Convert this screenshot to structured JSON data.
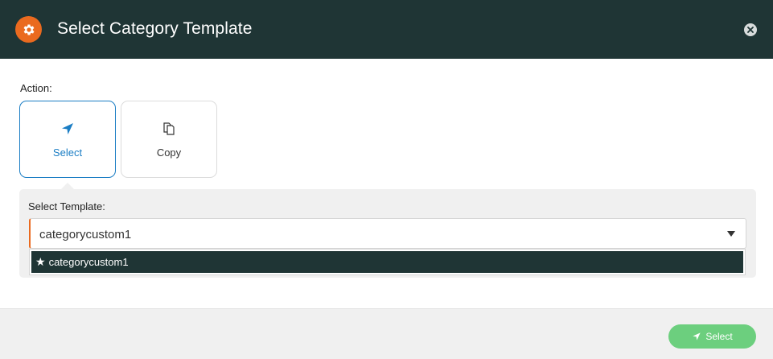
{
  "dialog": {
    "title": "Select Category Template",
    "header_icon": "gear-icon",
    "close_icon": "close-icon"
  },
  "action": {
    "label": "Action:",
    "options": [
      {
        "label": "Select",
        "icon": "send-icon",
        "selected": true
      },
      {
        "label": "Copy",
        "icon": "copy-icon",
        "selected": false
      }
    ]
  },
  "template": {
    "label": "Select Template:",
    "value": "categorycustom1",
    "options": [
      {
        "label": "categorycustom1",
        "icon": "star-icon",
        "highlighted": true
      }
    ]
  },
  "footer": {
    "select_button_label": "Select",
    "select_button_icon": "send-icon"
  },
  "colors": {
    "header_bg": "#1f3535",
    "accent_orange": "#ea6a1f",
    "selected_blue": "#1a7dc4",
    "button_green": "#6ccf7e"
  }
}
